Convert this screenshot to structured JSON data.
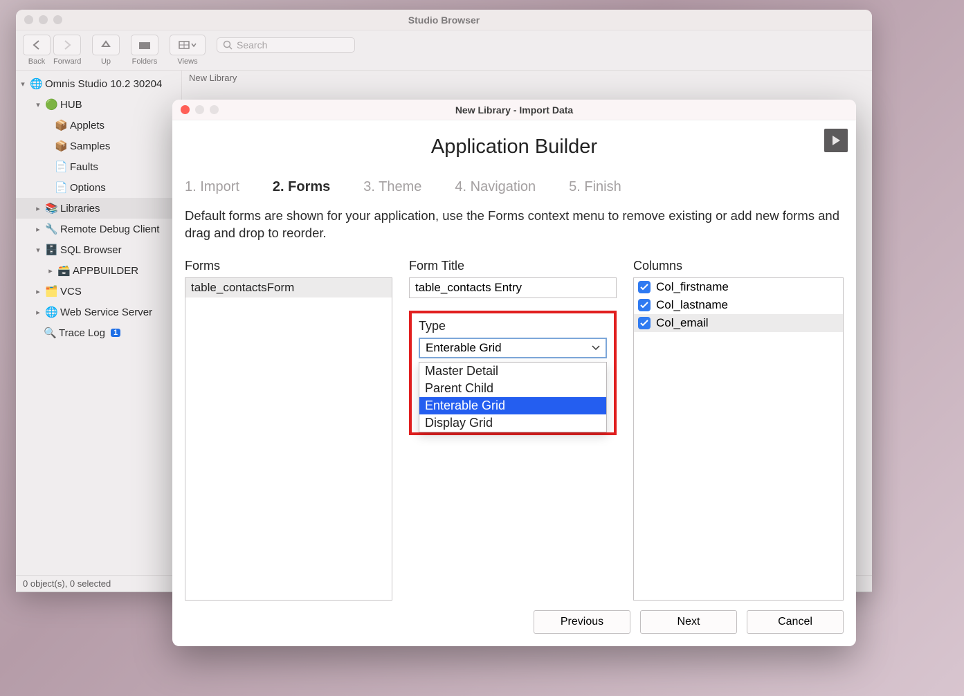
{
  "browser": {
    "title": "Studio Browser",
    "toolbar": {
      "back": "Back",
      "forward": "Forward",
      "up": "Up",
      "folders": "Folders",
      "views": "Views",
      "search_placeholder": "Search"
    },
    "status": "0 object(s), 0 selected",
    "crumb": "New Library"
  },
  "tree": {
    "root": "Omnis Studio 10.2 30204",
    "hub": "HUB",
    "applets": "Applets",
    "samples": "Samples",
    "faults": "Faults",
    "options": "Options",
    "libraries": "Libraries",
    "remote_debug": "Remote Debug Client",
    "sql_browser": "SQL Browser",
    "appbuilder": "APPBUILDER",
    "vcs": "VCS",
    "wss": "Web Service Server",
    "trace_log": "Trace Log",
    "trace_badge": "1"
  },
  "modal": {
    "title": "New Library - Import Data",
    "heading": "Application Builder",
    "steps": [
      "1. Import",
      "2. Forms",
      "3. Theme",
      "4. Navigation",
      "5. Finish"
    ],
    "active_step": 1,
    "description": "Default forms are shown for your application, use the Forms context menu to remove existing or add new forms and drag and drop to reorder.",
    "forms_label": "Forms",
    "forms_list": [
      "table_contactsForm"
    ],
    "form_title_label": "Form Title",
    "form_title_value": "table_contacts Entry",
    "type_label": "Type",
    "type_selected": "Enterable Grid",
    "type_options": [
      "Master Detail",
      "Parent Child",
      "Enterable Grid",
      "Display Grid"
    ],
    "columns_label": "Columns",
    "columns": [
      {
        "label": "Col_firstname",
        "checked": true,
        "selected": false
      },
      {
        "label": "Col_lastname",
        "checked": true,
        "selected": false
      },
      {
        "label": "Col_email",
        "checked": true,
        "selected": true
      }
    ],
    "buttons": {
      "previous": "Previous",
      "next": "Next",
      "cancel": "Cancel"
    }
  }
}
